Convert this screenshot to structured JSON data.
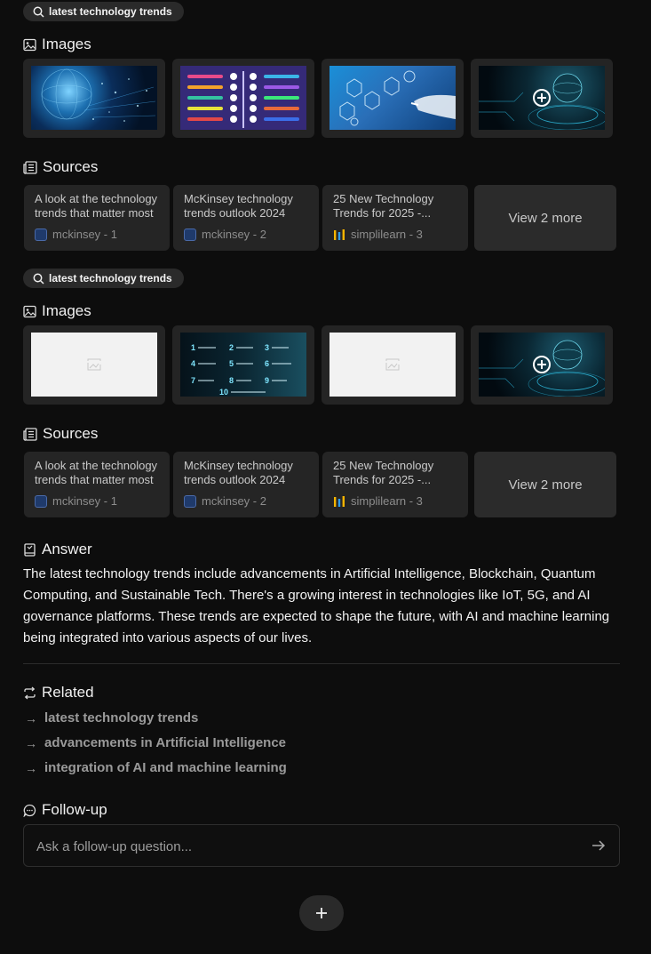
{
  "blocks": [
    {
      "query": "latest technology trends",
      "images_label": "Images",
      "images": [
        {
          "alt": "glowing-globe-network"
        },
        {
          "alt": "new-technology-trends-infographic"
        },
        {
          "alt": "robot-hand-touch-icons"
        },
        {
          "alt": "globe-circuit-more"
        }
      ],
      "sources_label": "Sources",
      "sources": [
        {
          "title": "A look at the technology trends that matter most",
          "site": "mckinsey - 1"
        },
        {
          "title": "McKinsey technology trends outlook 2024",
          "site": "mckinsey - 2"
        },
        {
          "title": "25 New Technology Trends for 2025 -...",
          "site": "simplilearn - 3"
        }
      ],
      "more_label": "View 2 more"
    },
    {
      "query": "latest technology trends",
      "images_label": "Images",
      "images": [
        {
          "alt": "broken-image-placeholder"
        },
        {
          "alt": "top-10-technology-list"
        },
        {
          "alt": "broken-image-placeholder"
        },
        {
          "alt": "globe-circuit-more"
        }
      ],
      "sources_label": "Sources",
      "sources": [
        {
          "title": "A look at the technology trends that matter most",
          "site": "mckinsey - 1"
        },
        {
          "title": "McKinsey technology trends outlook 2024",
          "site": "mckinsey - 2"
        },
        {
          "title": "25 New Technology Trends for 2025 -...",
          "site": "simplilearn - 3"
        }
      ],
      "more_label": "View 2 more"
    }
  ],
  "answer": {
    "label": "Answer",
    "text": "The latest technology trends include advancements in Artificial Intelligence, Blockchain, Quantum Computing, and Sustainable Tech. There's a growing interest in technologies like IoT, 5G, and AI governance platforms. These trends are expected to shape the future, with AI and machine learning being integrated into various aspects of our lives."
  },
  "related": {
    "label": "Related",
    "items": [
      "latest technology trends",
      "advancements in Artificial Intelligence",
      "integration of AI and machine learning"
    ]
  },
  "followup": {
    "label": "Follow-up",
    "placeholder": "Ask a follow-up question..."
  },
  "colors": {
    "background": "#0d0d0d",
    "card": "#252525",
    "chip": "#2a2a2a",
    "muted_text": "#9a9a9a"
  },
  "icons": {
    "query": "search-icon",
    "images": "image-icon",
    "sources": "newspaper-icon",
    "answer": "book-icon",
    "related": "repeat-icon",
    "followup": "chat-bubble-icon",
    "send": "arrow-right-icon",
    "new": "plus-icon"
  }
}
